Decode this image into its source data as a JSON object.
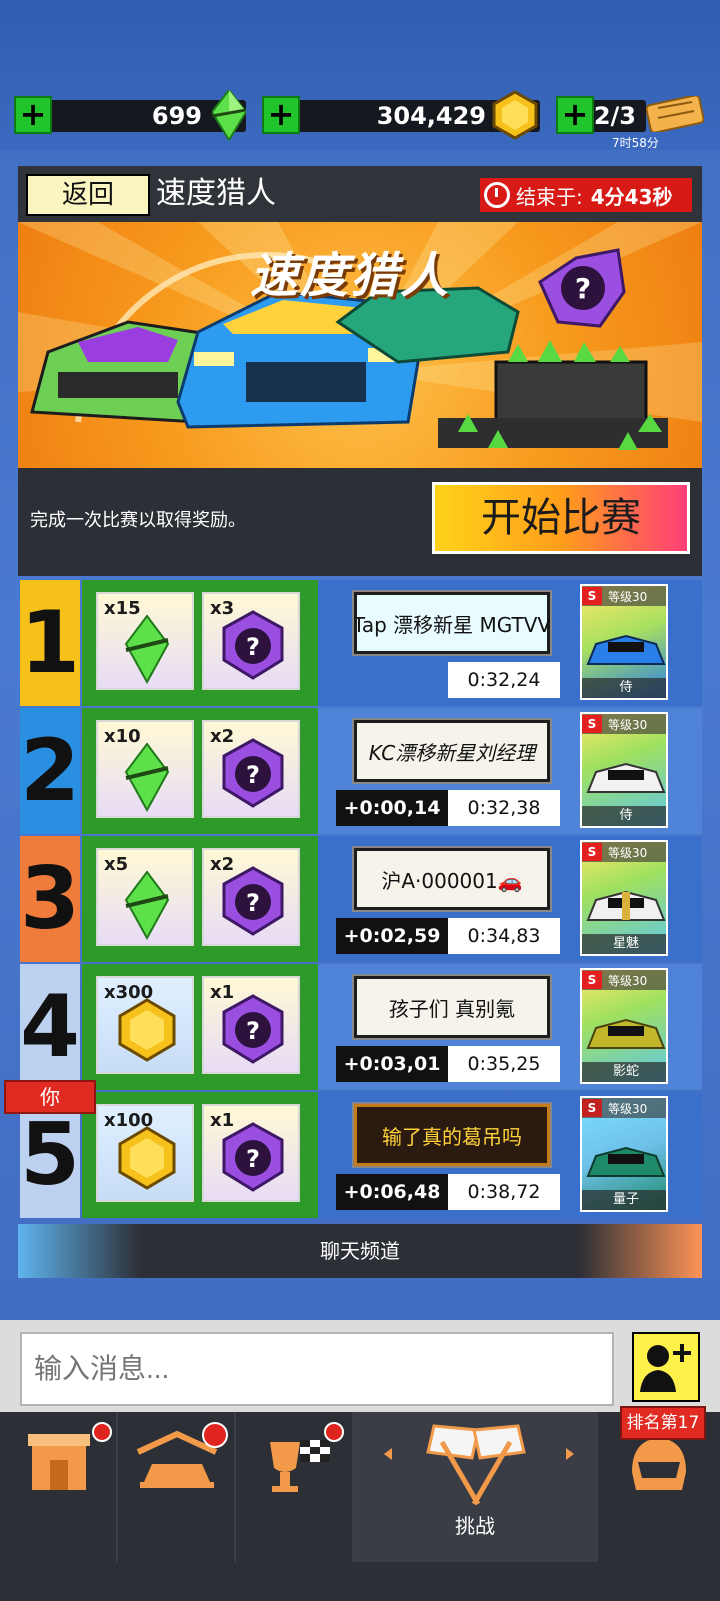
{
  "currency": {
    "gems": "699",
    "coins": "304,429",
    "tickets": "2/3",
    "ticket_timer": "7时58分",
    "plus_label": "+"
  },
  "panel": {
    "back_label": "返回",
    "title": "速度猎人",
    "timer_label": "结束于:",
    "timer_value": "4分43秒",
    "banner_title": "速度猎人",
    "description": "完成一次比赛以取得奖励。",
    "start_label": "开始比赛"
  },
  "leaderboard": [
    {
      "rank": "1",
      "rank_color": "#f6c21a",
      "reward1_qty": "x15",
      "reward1": "gem",
      "reward2_qty": "x3",
      "plate": "Tap 漂移新星 MGTVV",
      "delta": "",
      "time": "0:32,24",
      "car_name": "侍",
      "car_level": "等级30",
      "car_color": "#2a7ee8"
    },
    {
      "rank": "2",
      "rank_color": "#2a8fe0",
      "reward1_qty": "x10",
      "reward1": "gem",
      "reward2_qty": "x2",
      "plate": "KC漂移新星刘经理",
      "delta": "+0:00,14",
      "time": "0:32,38",
      "car_name": "侍",
      "car_level": "等级30",
      "car_color": "#e8e8e8"
    },
    {
      "rank": "3",
      "rank_color": "#f07c3c",
      "reward1_qty": "x5",
      "reward1": "gem",
      "reward2_qty": "x2",
      "plate": "沪A·000001🚗",
      "delta": "+0:02,59",
      "time": "0:34,83",
      "car_name": "星魅",
      "car_level": "等级30",
      "car_color": "#f0f0f0"
    },
    {
      "rank": "4",
      "rank_color": "#bcd2f0",
      "reward1_qty": "x300",
      "reward1": "coin",
      "reward2_qty": "x1",
      "plate": "孩子们 真别氪",
      "delta": "+0:03,01",
      "time": "0:35,25",
      "car_name": "影蛇",
      "car_level": "等级30",
      "car_color": "#c2b62a"
    },
    {
      "rank": "5",
      "rank_color": "#bcd2f0",
      "reward1_qty": "x100",
      "reward1": "coin",
      "reward2_qty": "x1",
      "plate": "输了真的葛吊吗",
      "delta": "+0:06,48",
      "time": "0:38,72",
      "car_name": "量子",
      "car_level": "等级30",
      "car_color": "#1f8a6a"
    }
  ],
  "you_label": "你",
  "chat": {
    "title": "聊天频道",
    "placeholder": "输入消息..."
  },
  "tabs": {
    "challenge_label": "挑战",
    "rank_badge": "排名第17"
  }
}
